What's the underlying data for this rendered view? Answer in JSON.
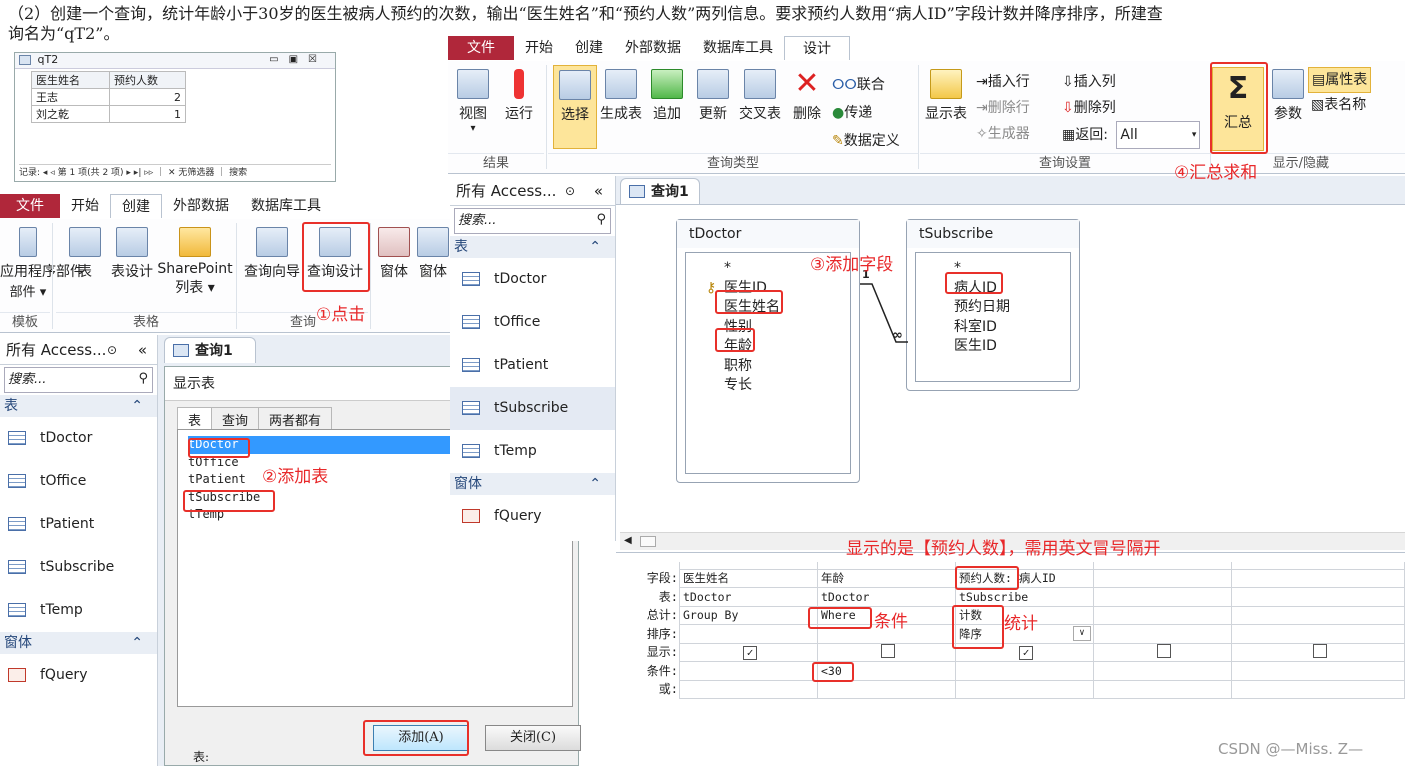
{
  "instruction": {
    "line1": "（2）创建一个查询，统计年龄小于30岁的医生被病人预约的次数，输出“医生姓名”和“预约人数”两列信息。要求预约人数用“病人ID”字段计数并降序排序，所建查",
    "line2": "询名为“qT2”。"
  },
  "result_window": {
    "title": "qT2",
    "title_buttons": [
      "▭",
      "▣",
      "☒"
    ],
    "columns": [
      "医生姓名",
      "预约人数"
    ],
    "rows": [
      {
        "name": "王志",
        "count": "2"
      },
      {
        "name": "刘之乾",
        "count": "1"
      }
    ],
    "nav_text": "记录: ◂  ◃ 第 1 项(共 2 项) ▸  ▸|  ▹▹  ｜ ✕ 无筛选器 ｜ 搜索"
  },
  "ribbon_left": {
    "tabs": [
      "文件",
      "开始",
      "创建",
      "外部数据",
      "数据库工具"
    ],
    "active_tab": "创建",
    "buttons": {
      "app_parts": "应用程序部件",
      "app_parts_sub": "部件 ▾",
      "table": "表",
      "table_design": "表设计",
      "sharepoint": "SharePoint",
      "sharepoint_sub": "列表 ▾",
      "query_wizard": "查询向导",
      "query_design": "查询设计",
      "form": "窗体",
      "form2": "窗体"
    },
    "groups": {
      "templates": "模板",
      "tables": "表格",
      "queries": "查询"
    }
  },
  "ribbon_right": {
    "tabs": [
      "文件",
      "开始",
      "创建",
      "外部数据",
      "数据库工具",
      "设计"
    ],
    "active_tab": "设计",
    "buttons": {
      "view": "视图",
      "run": "运行",
      "select": "选择",
      "make_table": "生成表",
      "append": "追加",
      "update": "更新",
      "crosstab": "交叉表",
      "delete": "删除",
      "union": "联合",
      "passthrough": "传递",
      "data_def": "数据定义",
      "show_table": "显示表",
      "insert_rows": "插入行",
      "delete_rows": "删除行",
      "builder": "生成器",
      "insert_cols": "插入列",
      "delete_cols": "删除列",
      "return_label": "返回:",
      "return_value": "All",
      "totals": "汇总",
      "params": "参数",
      "property_sheet": "属性表",
      "table_names": "表名称"
    },
    "groups": {
      "results": "结果",
      "query_type": "查询类型",
      "query_setup": "查询设置",
      "show_hide": "显示/隐藏"
    }
  },
  "nav_pane": {
    "header": "所有 Access...",
    "search_placeholder": "搜索...",
    "section_tables": "表",
    "tables": [
      "tDoctor",
      "tOffice",
      "tPatient",
      "tSubscribe",
      "tTemp"
    ],
    "section_forms": "窗体",
    "forms": [
      "fQuery"
    ]
  },
  "query_tab_label": "查询1",
  "show_table_dialog": {
    "title": "显示表",
    "tabs": [
      "表",
      "查询",
      "两者都有"
    ],
    "items": [
      "tDoctor",
      "tOffice",
      "tPatient",
      "tSubscribe",
      "tTemp"
    ],
    "add_button": "添加(A)",
    "close_button": "关闭(C)",
    "bottom_label": "表:"
  },
  "design_tables": {
    "tDoctor": {
      "title": "tDoctor",
      "fields": [
        "*",
        "医生ID",
        "医生姓名",
        "性别",
        "年龄",
        "职称",
        "专长"
      ]
    },
    "tSubscribe": {
      "title": "tSubscribe",
      "fields": [
        "*",
        "病人ID",
        "预约日期",
        "科室ID",
        "医生ID"
      ]
    },
    "relation": {
      "one": "1",
      "many": "∞"
    }
  },
  "qbe_grid": {
    "row_labels": [
      "字段:",
      "表:",
      "总计:",
      "排序:",
      "显示:",
      "条件:",
      "或:"
    ],
    "columns": [
      {
        "field": "医生姓名",
        "table": "tDoctor",
        "total": "Group By",
        "sort": "",
        "show": true,
        "criteria": ""
      },
      {
        "field": "年龄",
        "table": "tDoctor",
        "total": "Where",
        "sort": "",
        "show": false,
        "criteria": "<30"
      },
      {
        "field": "预约人数: 病人ID",
        "table": "tSubscribe",
        "total": "计数",
        "sort": "降序",
        "show": true,
        "criteria": ""
      },
      {
        "field": "",
        "table": "",
        "total": "",
        "sort": "",
        "show": false,
        "criteria": ""
      },
      {
        "field": "",
        "table": "",
        "total": "",
        "sort": "",
        "show": false,
        "criteria": ""
      }
    ]
  },
  "annotations": {
    "step1": "①点击",
    "step2": "②添加表",
    "step3": "③添加字段",
    "step4": "④汇总求和",
    "note_display": "显示的是【预约人数】，需用英文冒号隔开",
    "note_condition": "条件",
    "note_stat": "统计"
  },
  "watermark": "CSDN @—Miss. Z—",
  "colors": {
    "file_tab": "#b0273a",
    "annotation_red": "#e8282a",
    "highlight_yellow": "#fde59a"
  }
}
